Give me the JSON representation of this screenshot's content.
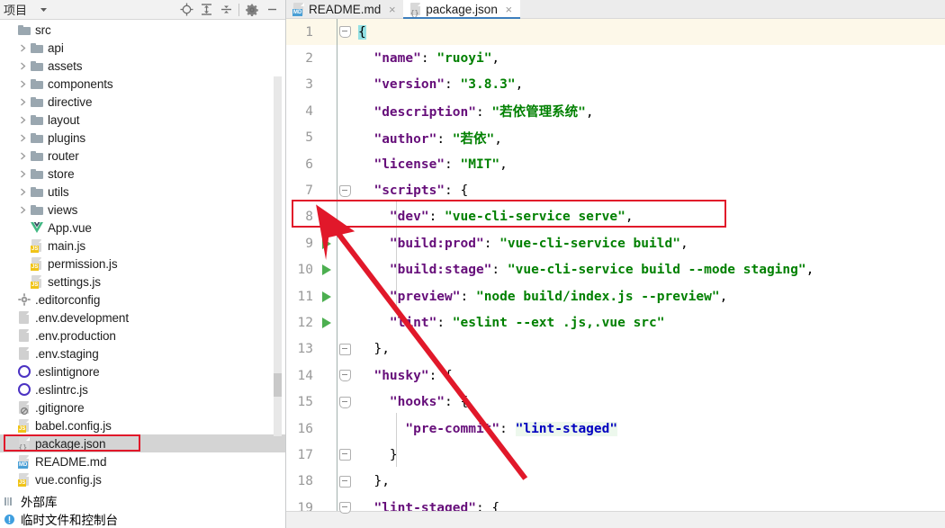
{
  "panel": {
    "title": "项目",
    "caret_icon": "chevron-down-icon",
    "tools": [
      {
        "name": "locate-icon",
        "label": "定位"
      },
      {
        "name": "expand-all-icon",
        "label": "全部展开"
      },
      {
        "name": "collapse-all-icon",
        "label": "全部折叠"
      },
      {
        "name": "settings-gear-icon",
        "label": "设置"
      },
      {
        "name": "minimize-icon",
        "label": "隐藏"
      }
    ],
    "tree": [
      {
        "label": "src",
        "type": "folder",
        "arrow": false,
        "indent": 0,
        "selected": false
      },
      {
        "label": "api",
        "type": "folder",
        "arrow": true,
        "indent": 1,
        "selected": false
      },
      {
        "label": "assets",
        "type": "folder",
        "arrow": true,
        "indent": 1,
        "selected": false
      },
      {
        "label": "components",
        "type": "folder",
        "arrow": true,
        "indent": 1,
        "selected": false
      },
      {
        "label": "directive",
        "type": "folder",
        "arrow": true,
        "indent": 1,
        "selected": false
      },
      {
        "label": "layout",
        "type": "folder",
        "arrow": true,
        "indent": 1,
        "selected": false
      },
      {
        "label": "plugins",
        "type": "folder",
        "arrow": true,
        "indent": 1,
        "selected": false
      },
      {
        "label": "router",
        "type": "folder",
        "arrow": true,
        "indent": 1,
        "selected": false
      },
      {
        "label": "store",
        "type": "folder",
        "arrow": true,
        "indent": 1,
        "selected": false
      },
      {
        "label": "utils",
        "type": "folder",
        "arrow": true,
        "indent": 1,
        "selected": false
      },
      {
        "label": "views",
        "type": "folder",
        "arrow": true,
        "indent": 1,
        "selected": false
      },
      {
        "label": "App.vue",
        "type": "vue",
        "arrow": false,
        "indent": 1,
        "selected": false
      },
      {
        "label": "main.js",
        "type": "js",
        "arrow": false,
        "indent": 1,
        "selected": false
      },
      {
        "label": "permission.js",
        "type": "js",
        "arrow": false,
        "indent": 1,
        "selected": false
      },
      {
        "label": "settings.js",
        "type": "js",
        "arrow": false,
        "indent": 1,
        "selected": false
      },
      {
        "label": ".editorconfig",
        "type": "gear",
        "arrow": false,
        "indent": 0,
        "selected": false
      },
      {
        "label": ".env.development",
        "type": "text",
        "arrow": false,
        "indent": 0,
        "selected": false
      },
      {
        "label": ".env.production",
        "type": "text",
        "arrow": false,
        "indent": 0,
        "selected": false
      },
      {
        "label": ".env.staging",
        "type": "text",
        "arrow": false,
        "indent": 0,
        "selected": false
      },
      {
        "label": ".eslintignore",
        "type": "eslint",
        "arrow": false,
        "indent": 0,
        "selected": false
      },
      {
        "label": ".eslintrc.js",
        "type": "eslint",
        "arrow": false,
        "indent": 0,
        "selected": false
      },
      {
        "label": ".gitignore",
        "type": "gitignore",
        "arrow": false,
        "indent": 0,
        "selected": false
      },
      {
        "label": "babel.config.js",
        "type": "js",
        "arrow": false,
        "indent": 0,
        "selected": false
      },
      {
        "label": "package.json",
        "type": "json",
        "arrow": false,
        "indent": 0,
        "selected": true
      },
      {
        "label": "README.md",
        "type": "md",
        "arrow": false,
        "indent": 0,
        "selected": false
      },
      {
        "label": "vue.config.js",
        "type": "js",
        "arrow": false,
        "indent": 0,
        "selected": false
      }
    ],
    "footer": [
      {
        "label": "外部库",
        "type": "library"
      },
      {
        "label": "临时文件和控制台",
        "type": "scratch"
      }
    ]
  },
  "editor": {
    "tabs": [
      {
        "label": "README.md",
        "icon": "markdown-file-icon",
        "active": false,
        "close": "×"
      },
      {
        "label": "package.json",
        "icon": "json-file-icon",
        "active": true,
        "close": "×"
      }
    ],
    "lines": [
      {
        "num": "1",
        "run": false,
        "fold": "tip",
        "caret": true,
        "segments": [
          {
            "t": "{",
            "c": "brk"
          }
        ]
      },
      {
        "num": "2",
        "run": false,
        "fold": "",
        "caret": false,
        "segments": [
          {
            "t": "  \"name\"",
            "c": "k"
          },
          {
            "t": ": ",
            "c": "p"
          },
          {
            "t": "\"ruoyi\"",
            "c": "s"
          },
          {
            "t": ",",
            "c": "p"
          }
        ]
      },
      {
        "num": "3",
        "run": false,
        "fold": "",
        "caret": false,
        "segments": [
          {
            "t": "  \"version\"",
            "c": "k"
          },
          {
            "t": ": ",
            "c": "p"
          },
          {
            "t": "\"3.8.3\"",
            "c": "s"
          },
          {
            "t": ",",
            "c": "p"
          }
        ]
      },
      {
        "num": "4",
        "run": false,
        "fold": "",
        "caret": false,
        "segments": [
          {
            "t": "  \"description\"",
            "c": "k"
          },
          {
            "t": ": ",
            "c": "p"
          },
          {
            "t": "\"若依管理系统\"",
            "c": "s"
          },
          {
            "t": ",",
            "c": "p"
          }
        ]
      },
      {
        "num": "5",
        "run": false,
        "fold": "",
        "caret": false,
        "segments": [
          {
            "t": "  \"author\"",
            "c": "k"
          },
          {
            "t": ": ",
            "c": "p"
          },
          {
            "t": "\"若依\"",
            "c": "s"
          },
          {
            "t": ",",
            "c": "p"
          }
        ]
      },
      {
        "num": "6",
        "run": false,
        "fold": "",
        "caret": false,
        "segments": [
          {
            "t": "  \"license\"",
            "c": "k"
          },
          {
            "t": ": ",
            "c": "p"
          },
          {
            "t": "\"MIT\"",
            "c": "s"
          },
          {
            "t": ",",
            "c": "p"
          }
        ]
      },
      {
        "num": "7",
        "run": false,
        "fold": "tip",
        "caret": false,
        "segments": [
          {
            "t": "  \"scripts\"",
            "c": "k"
          },
          {
            "t": ": {",
            "c": "p"
          }
        ]
      },
      {
        "num": "8",
        "run": true,
        "fold": "",
        "caret": false,
        "segments": [
          {
            "t": "    \"dev\"",
            "c": "k"
          },
          {
            "t": ": ",
            "c": "p"
          },
          {
            "t": "\"vue-cli-service serve\"",
            "c": "s"
          },
          {
            "t": ",",
            "c": "p"
          }
        ]
      },
      {
        "num": "9",
        "run": true,
        "fold": "",
        "caret": false,
        "segments": [
          {
            "t": "    \"build:prod\"",
            "c": "k"
          },
          {
            "t": ": ",
            "c": "p"
          },
          {
            "t": "\"vue-cli-service build\"",
            "c": "s"
          },
          {
            "t": ",",
            "c": "p"
          }
        ]
      },
      {
        "num": "10",
        "run": true,
        "fold": "",
        "caret": false,
        "segments": [
          {
            "t": "    \"build:stage\"",
            "c": "k"
          },
          {
            "t": ": ",
            "c": "p"
          },
          {
            "t": "\"vue-cli-service build --mode staging\"",
            "c": "s"
          },
          {
            "t": ",",
            "c": "p"
          }
        ]
      },
      {
        "num": "11",
        "run": true,
        "fold": "",
        "caret": false,
        "segments": [
          {
            "t": "    \"preview\"",
            "c": "k"
          },
          {
            "t": ": ",
            "c": "p"
          },
          {
            "t": "\"node build/index.js --preview\"",
            "c": "s"
          },
          {
            "t": ",",
            "c": "p"
          }
        ]
      },
      {
        "num": "12",
        "run": true,
        "fold": "",
        "caret": false,
        "segments": [
          {
            "t": "    \"lint\"",
            "c": "k"
          },
          {
            "t": ": ",
            "c": "p"
          },
          {
            "t": "\"eslint --ext .js,.vue src\"",
            "c": "s"
          }
        ]
      },
      {
        "num": "13",
        "run": false,
        "fold": "end",
        "caret": false,
        "segments": [
          {
            "t": "  },",
            "c": "p"
          }
        ]
      },
      {
        "num": "14",
        "run": false,
        "fold": "tip",
        "caret": false,
        "segments": [
          {
            "t": "  \"husky\"",
            "c": "k"
          },
          {
            "t": ": {",
            "c": "p"
          }
        ]
      },
      {
        "num": "15",
        "run": false,
        "fold": "tip",
        "caret": false,
        "segments": [
          {
            "t": "    \"hooks\"",
            "c": "k"
          },
          {
            "t": ": {",
            "c": "p"
          }
        ]
      },
      {
        "num": "16",
        "run": false,
        "fold": "",
        "caret": false,
        "segments": [
          {
            "t": "      \"pre-commit\"",
            "c": "k"
          },
          {
            "t": ": ",
            "c": "p"
          },
          {
            "t": "\"lint-staged\"",
            "c": "hl"
          }
        ]
      },
      {
        "num": "17",
        "run": false,
        "fold": "end",
        "caret": false,
        "segments": [
          {
            "t": "    }",
            "c": "p"
          }
        ]
      },
      {
        "num": "18",
        "run": false,
        "fold": "end",
        "caret": false,
        "segments": [
          {
            "t": "  },",
            "c": "p"
          }
        ]
      },
      {
        "num": "19",
        "run": false,
        "fold": "tip",
        "caret": false,
        "segments": [
          {
            "t": "  \"lint-staged\"",
            "c": "k"
          },
          {
            "t": ": {",
            "c": "p"
          }
        ]
      }
    ]
  },
  "annotations": {
    "highlight_color": "#e1182a",
    "arrow_color": "#e1182a",
    "code_redbox_line": "8",
    "tree_redbox_item": "package.json"
  }
}
